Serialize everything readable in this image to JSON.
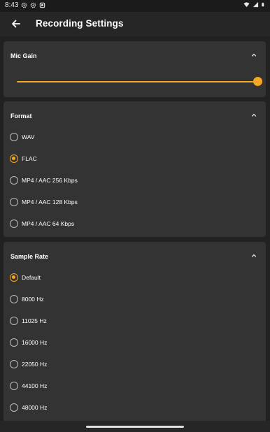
{
  "status_bar": {
    "time": "8:43"
  },
  "app_bar": {
    "title": "Recording Settings"
  },
  "mic_gain": {
    "title": "Mic Gain",
    "level": 1.0,
    "accent_color": "#f5a623"
  },
  "format": {
    "title": "Format",
    "options": [
      {
        "label": "WAV",
        "selected": false
      },
      {
        "label": "FLAC",
        "selected": true
      },
      {
        "label": "MP4 / AAC 256 Kbps",
        "selected": false
      },
      {
        "label": "MP4 / AAC 128 Kbps",
        "selected": false
      },
      {
        "label": "MP4 / AAC 64 Kbps",
        "selected": false
      }
    ]
  },
  "sample_rate": {
    "title": "Sample Rate",
    "options": [
      {
        "label": "Default",
        "selected": true
      },
      {
        "label": "8000 Hz",
        "selected": false
      },
      {
        "label": "11025 Hz",
        "selected": false
      },
      {
        "label": "16000 Hz",
        "selected": false
      },
      {
        "label": "22050 Hz",
        "selected": false
      },
      {
        "label": "44100 Hz",
        "selected": false
      },
      {
        "label": "48000 Hz",
        "selected": false
      }
    ]
  },
  "icons": {
    "back": "arrow-back-icon",
    "collapse": "chevron-up-icon",
    "status_left": [
      "settings-icon",
      "settings-icon",
      "notification-icon"
    ],
    "status_right": [
      "wifi-icon",
      "signal-icon",
      "battery-icon"
    ]
  }
}
